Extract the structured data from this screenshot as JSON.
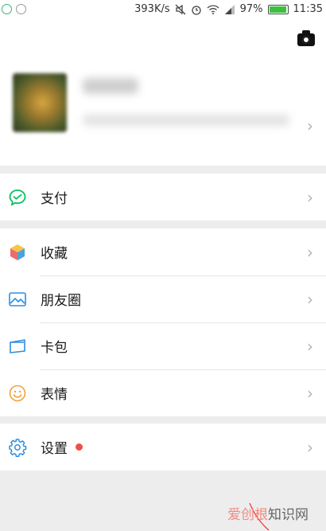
{
  "status_bar": {
    "speed": "393K/s",
    "battery_percent": "97%",
    "time": "11:35",
    "battery_level": 0.97,
    "left_icons": [
      "notification-icon",
      "app-icon"
    ],
    "right_icons": [
      "mute-icon",
      "alarm-icon",
      "wifi-icon",
      "signal-icon",
      "battery-icon"
    ]
  },
  "profile": {
    "camera_icon": "camera-icon",
    "chevron": "›"
  },
  "menu": {
    "pay": {
      "label": "支付",
      "icon": "wechat-pay-icon"
    },
    "favorites": {
      "label": "收藏",
      "icon": "favorites-cube-icon"
    },
    "moments": {
      "label": "朋友圈",
      "icon": "moments-photo-icon"
    },
    "cards": {
      "label": "卡包",
      "icon": "card-wallet-icon"
    },
    "stickers": {
      "label": "表情",
      "icon": "smiley-icon"
    },
    "settings": {
      "label": "设置",
      "icon": "gear-icon",
      "has_badge": true
    }
  },
  "chevron": "›",
  "watermark": {
    "part1": "爱创根",
    "part2": "知识网"
  },
  "colors": {
    "background": "#ededed",
    "pay_green": "#07c160",
    "link_blue": "#2e8ee0",
    "badge_red": "#f05045",
    "smiley_orange": "#f0a23a"
  }
}
